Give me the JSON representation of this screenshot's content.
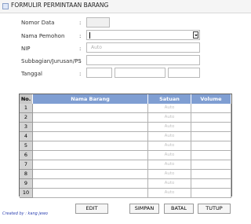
{
  "window": {
    "title": "FORMULIR PERMINTAAN BARANG"
  },
  "form": {
    "nomor_data": {
      "label": "Nomor Data",
      "value": ""
    },
    "nama_pemohon": {
      "label": "Nama Pemohon",
      "value": ""
    },
    "nip": {
      "label": "NIP",
      "placeholder": "Auto"
    },
    "subbagian": {
      "label": "Subbagian/Jurusan/PS",
      "value": ""
    },
    "tanggal": {
      "label": "Tanggal",
      "parts": [
        "",
        "",
        ""
      ]
    },
    "colon": ":"
  },
  "table": {
    "columns": [
      "No.",
      "Nama Barang",
      "Satuan",
      "Volume"
    ],
    "rows": [
      {
        "no": "1",
        "nama_barang": "",
        "satuan": "Auto",
        "volume": ""
      },
      {
        "no": "2",
        "nama_barang": "",
        "satuan": "Auto",
        "volume": ""
      },
      {
        "no": "3",
        "nama_barang": "",
        "satuan": "Auto",
        "volume": ""
      },
      {
        "no": "4",
        "nama_barang": "",
        "satuan": "Auto",
        "volume": ""
      },
      {
        "no": "5",
        "nama_barang": "",
        "satuan": "Auto",
        "volume": ""
      },
      {
        "no": "6",
        "nama_barang": "",
        "satuan": "Auto",
        "volume": ""
      },
      {
        "no": "7",
        "nama_barang": "",
        "satuan": "Auto",
        "volume": ""
      },
      {
        "no": "8",
        "nama_barang": "",
        "satuan": "Auto",
        "volume": ""
      },
      {
        "no": "9",
        "nama_barang": "",
        "satuan": "Auto",
        "volume": ""
      },
      {
        "no": "10",
        "nama_barang": "",
        "satuan": "Auto",
        "volume": ""
      }
    ]
  },
  "footer": {
    "credit": "Created by : kang jewo",
    "buttons": {
      "edit": "EDIT",
      "simpan": "SIMPAN",
      "batal": "BATAL",
      "tutup": "TUTUP"
    }
  },
  "colors": {
    "header_blue": "#7f9ed2",
    "credit_blue": "#2a3fb0"
  }
}
